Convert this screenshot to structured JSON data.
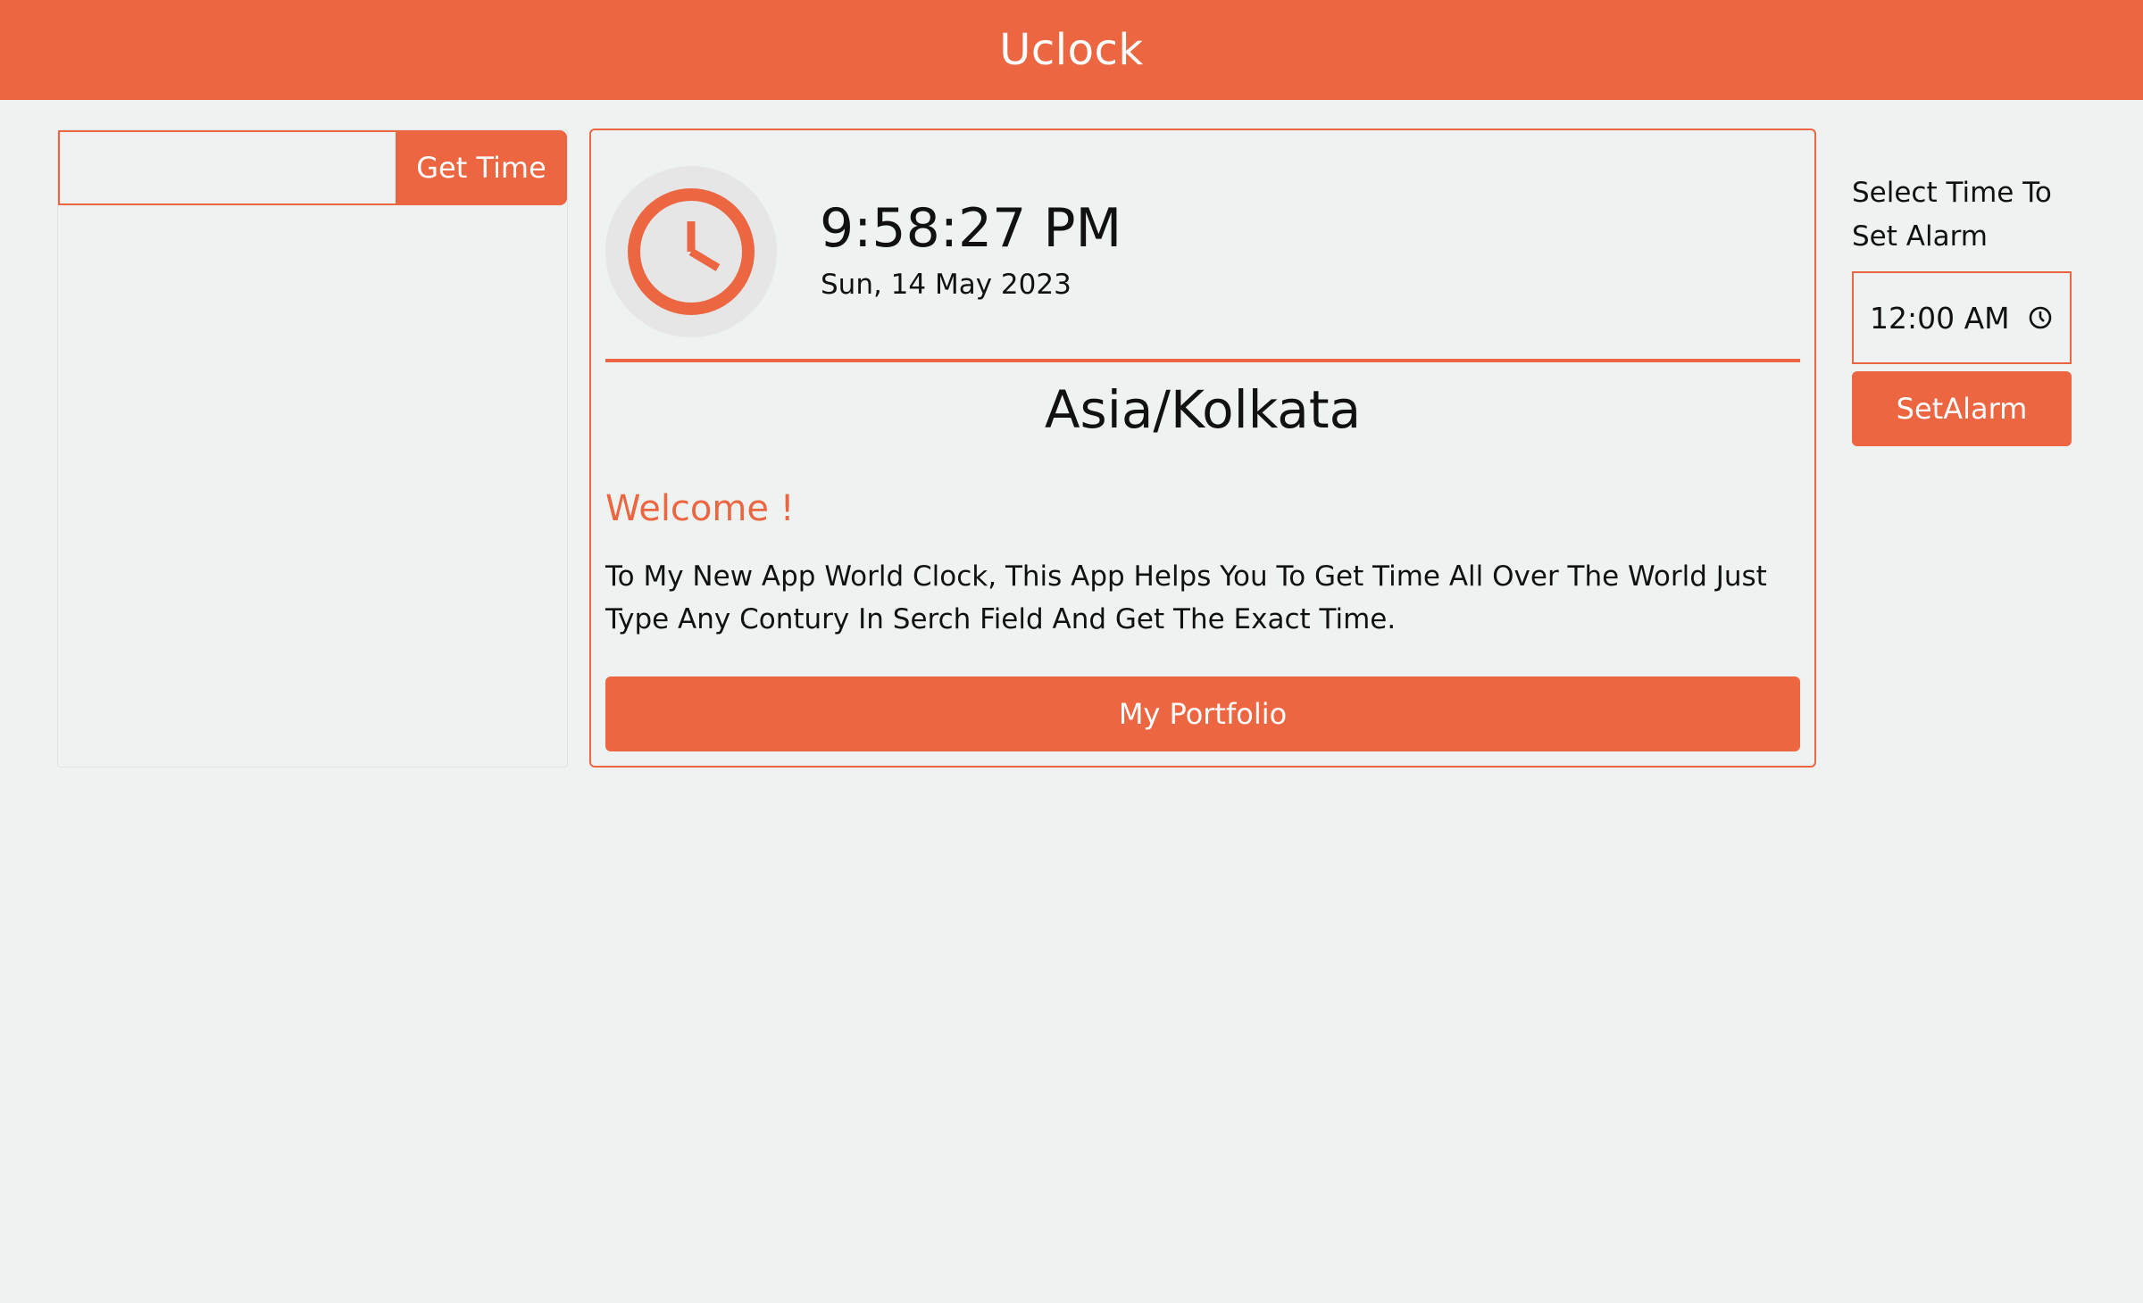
{
  "header": {
    "title": "Uclock"
  },
  "search": {
    "input_value": "",
    "placeholder": "",
    "button_label": "Get Time"
  },
  "clock": {
    "time": "9:58:27 PM",
    "date": "Sun, 14 May 2023",
    "timezone": "Asia/Kolkata",
    "icon": "clock-icon"
  },
  "welcome": {
    "heading": "Welcome !",
    "description": "To My New App World Clock, This App Helps You To Get Time All Over The World Just Type Any Contury In Serch Field And Get The Exact Time."
  },
  "portfolio": {
    "button_label": "My Portfolio"
  },
  "alarm": {
    "label": "Select Time To Set Alarm",
    "time_value": "12:00  AM",
    "button_label": "SetAlarm"
  },
  "colors": {
    "accent": "#ec6642",
    "background": "#eef3f2",
    "clock_bg": "#e6e6e6"
  }
}
